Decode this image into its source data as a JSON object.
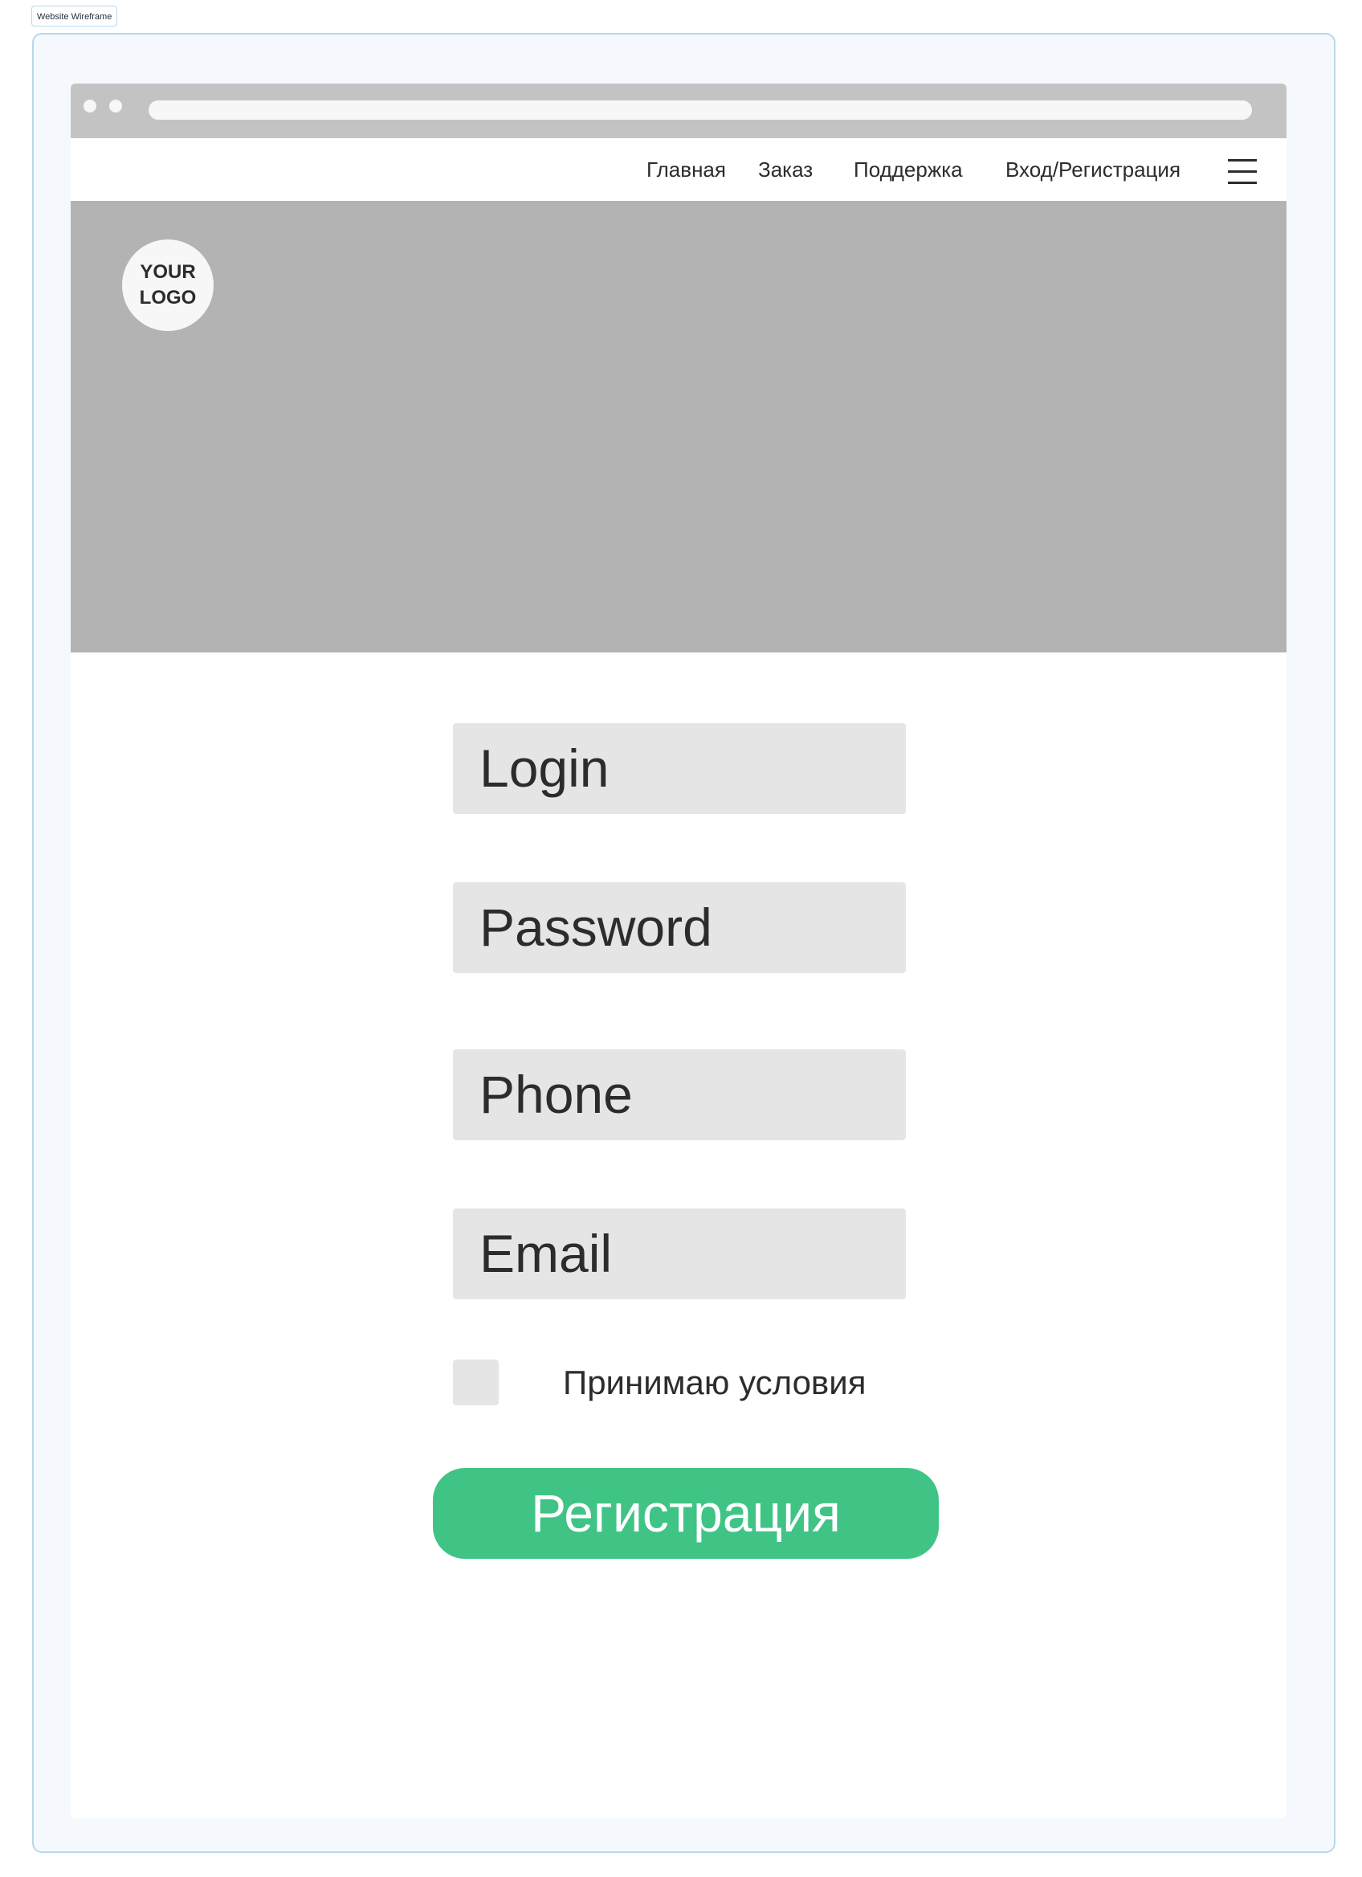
{
  "frame": {
    "label": "Website Wireframe"
  },
  "nav": {
    "items": [
      "Главная",
      "Заказ",
      "Поддержка",
      "Вход/Регистрация"
    ],
    "menu_icon": "hamburger-menu-icon"
  },
  "hero": {
    "logo_line1": "YOUR",
    "logo_line2": "LOGO"
  },
  "form": {
    "login_placeholder": "Login",
    "password_placeholder": "Password",
    "phone_placeholder": "Phone",
    "email_placeholder": "Email",
    "terms_label": "Принимаю условия",
    "terms_checked": false,
    "submit_label": "Регистрация"
  },
  "colors": {
    "frame_border": "#b7d8ec",
    "frame_background": "#f5f9fd",
    "browser_bar": "#c3c3c3",
    "hero_placeholder": "#b3b3b3",
    "field_background": "#e5e5e5",
    "primary_button": "#3fc486",
    "text": "#2c2c2c"
  }
}
